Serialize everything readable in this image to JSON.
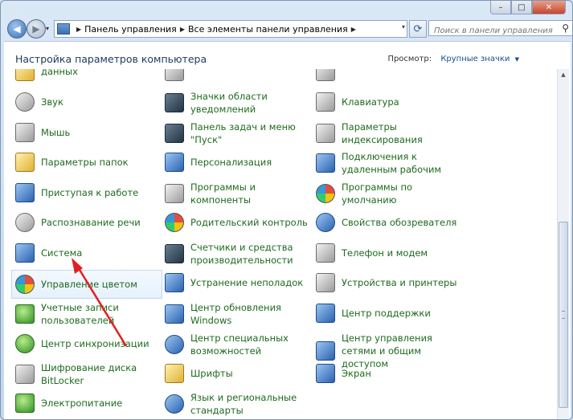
{
  "window": {
    "buttons": {
      "minimize": "–",
      "maximize": "□",
      "close": "✕"
    }
  },
  "nav": {
    "back_icon": "back-arrow-icon",
    "forward_icon": "forward-arrow-icon",
    "refresh_icon": "refresh-icon"
  },
  "breadcrumb": [
    "Панель управления",
    "Все элементы панели управления"
  ],
  "search": {
    "placeholder": "Поиск в панели управления"
  },
  "header": {
    "title": "Настройка параметров компьютера",
    "view_by_label": "Просмотр:",
    "view_by_value": "Крупные значки"
  },
  "columns": [
    [
      {
        "label": "данных",
        "icon": "backup-icon"
      },
      {
        "label": "Звук",
        "icon": "speaker-icon"
      },
      {
        "label": "Мышь",
        "icon": "mouse-icon"
      },
      {
        "label": "Параметры папок",
        "icon": "folder-options-icon"
      },
      {
        "label": "Приступая к работе",
        "icon": "getting-started-icon"
      },
      {
        "label": "Распознавание речи",
        "icon": "microphone-icon"
      },
      {
        "label": "Система",
        "icon": "computer-icon"
      },
      {
        "label": "Управление цветом",
        "icon": "color-management-icon",
        "selected": true
      },
      {
        "label": "Учетные записи пользователей",
        "icon": "users-icon"
      },
      {
        "label": "Центр синхронизации",
        "icon": "sync-center-icon"
      },
      {
        "label": "Шифрование диска BitLocker",
        "icon": "bitlocker-icon"
      },
      {
        "label": "Электропитание",
        "icon": "power-options-icon"
      }
    ],
    [
      {
        "label": "",
        "icon": "partial-icon"
      },
      {
        "label": "Значки области уведомлений",
        "icon": "notification-icons-icon"
      },
      {
        "label": "Панель задач и меню \"Пуск\"",
        "icon": "taskbar-icon"
      },
      {
        "label": "Персонализация",
        "icon": "personalization-icon"
      },
      {
        "label": "Программы и компоненты",
        "icon": "programs-features-icon"
      },
      {
        "label": "Родительский контроль",
        "icon": "parental-controls-icon"
      },
      {
        "label": "Счетчики и средства производительности",
        "icon": "performance-icon"
      },
      {
        "label": "Устранение неполадок",
        "icon": "troubleshooting-icon"
      },
      {
        "label": "Центр обновления Windows",
        "icon": "windows-update-icon"
      },
      {
        "label": "Центр специальных возможностей",
        "icon": "ease-of-access-icon"
      },
      {
        "label": "Шрифты",
        "icon": "fonts-icon"
      },
      {
        "label": "Язык и региональные стандарты",
        "icon": "region-language-icon"
      }
    ],
    [
      {
        "label": "",
        "icon": "partial-icon"
      },
      {
        "label": "Клавиатура",
        "icon": "keyboard-icon"
      },
      {
        "label": "Параметры индексирования",
        "icon": "indexing-icon"
      },
      {
        "label": "Подключения к удаленным рабочим",
        "icon": "remote-desktop-icon"
      },
      {
        "label": "Программы по умолчанию",
        "icon": "default-programs-icon"
      },
      {
        "label": "Свойства обозревателя",
        "icon": "internet-options-icon"
      },
      {
        "label": "Телефон и модем",
        "icon": "phone-modem-icon"
      },
      {
        "label": "Устройства и принтеры",
        "icon": "devices-printers-icon"
      },
      {
        "label": "Центр поддержки",
        "icon": "action-center-icon"
      },
      {
        "label": "Центр управления сетями и общим доступом",
        "icon": "network-center-icon"
      },
      {
        "label": "Экран",
        "icon": "display-icon"
      }
    ]
  ],
  "annotation": {
    "color": "#e02020"
  }
}
